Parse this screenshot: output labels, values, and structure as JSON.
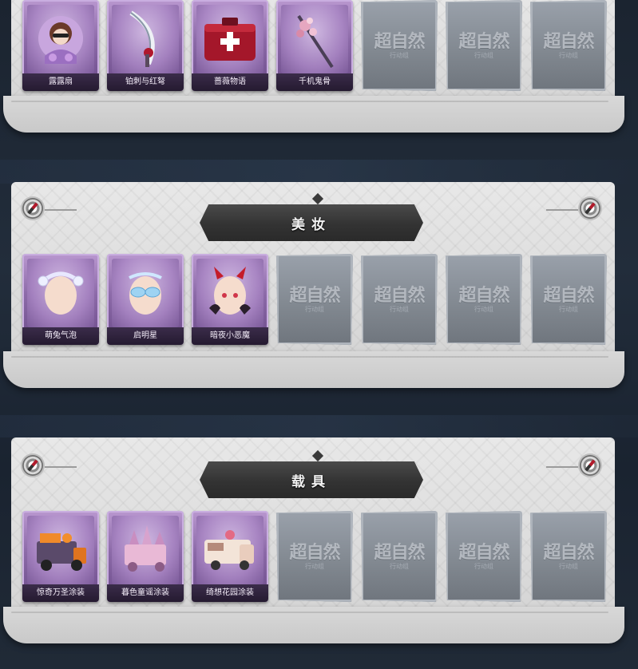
{
  "sections": [
    {
      "title": "",
      "items": [
        {
          "label": "露露扇",
          "icon": "girl-fan-icon"
        },
        {
          "label": "铂刺与红弩",
          "icon": "crossbow-blade-icon"
        },
        {
          "label": "蔷薇物语",
          "icon": "medkit-icon"
        },
        {
          "label": "千机鬼骨",
          "icon": "floral-staff-icon"
        }
      ],
      "empty_count": 3
    },
    {
      "title": "美妆",
      "items": [
        {
          "label": "萌兔气泡",
          "icon": "bubble-headband-icon"
        },
        {
          "label": "启明星",
          "icon": "star-glasses-icon"
        },
        {
          "label": "暗夜小恶魔",
          "icon": "devil-horns-icon"
        }
      ],
      "empty_count": 4
    },
    {
      "title": "载具",
      "items": [
        {
          "label": "惊奇万圣涂装",
          "icon": "halloween-truck-icon"
        },
        {
          "label": "暮色童谣涂装",
          "icon": "castle-carriage-icon"
        },
        {
          "label": "绮想花园涂装",
          "icon": "garden-van-icon"
        }
      ],
      "empty_count": 4
    }
  ],
  "empty_slot": {
    "brand": "超自然",
    "sub": "行动组"
  },
  "colors": {
    "card_purple": "#8c6aa8",
    "empty_gray": "#80878f",
    "banner": "#333333",
    "panel": "#dcdcdc"
  }
}
